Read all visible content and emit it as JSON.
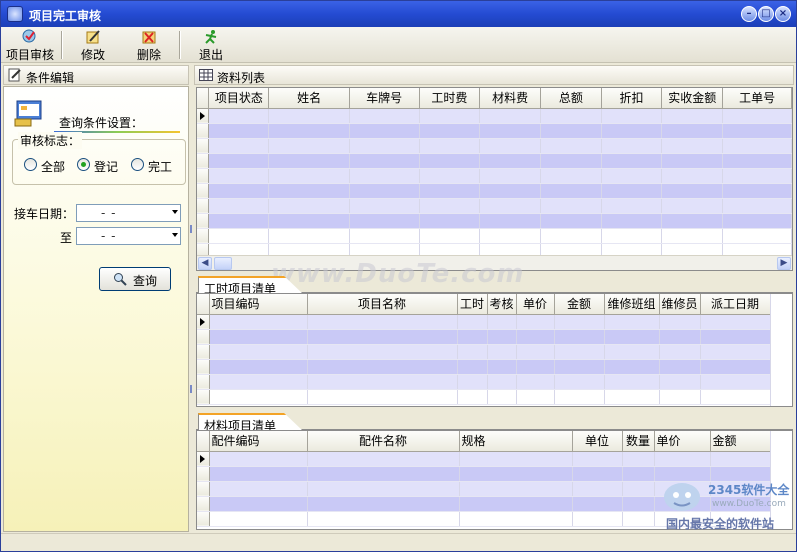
{
  "window": {
    "title": "项目完工审核"
  },
  "toolbar": {
    "items": [
      {
        "label": "项目审核",
        "icon": "audit-icon"
      },
      {
        "label": "修改",
        "icon": "edit-icon"
      },
      {
        "label": "删除",
        "icon": "delete-icon"
      },
      {
        "label": "退出",
        "icon": "exit-icon"
      }
    ]
  },
  "left": {
    "header": "条件编辑",
    "condition_title": "查询条件设置：",
    "audit_flag": {
      "label": "审核标志：",
      "options": [
        "全部",
        "登记",
        "完工"
      ],
      "selected": "登记"
    },
    "date_label": "接车日期：",
    "to_label": "至",
    "date_from": "-  -",
    "date_to": "-  -",
    "query_button": "查询"
  },
  "list": {
    "header": "资料列表",
    "columns": [
      "项目状态",
      "姓名",
      "车牌号",
      "工时费",
      "材料费",
      "总额",
      "折扣",
      "实收金额",
      "工单号"
    ]
  },
  "labor": {
    "tab": "工时项目清单",
    "columns": [
      "项目编码",
      "项目名称",
      "工时",
      "考核",
      "单价",
      "金额",
      "维修班组",
      "维修员",
      "派工日期"
    ]
  },
  "material": {
    "tab": "材料项目清单",
    "columns": [
      "配件编码",
      "配件名称",
      "规格",
      "单位",
      "数量",
      "单价",
      "金额"
    ]
  },
  "watermark": "www.DuoTe.com",
  "badge": {
    "brand": "2345软件大全",
    "url": "www.DuoTe.com",
    "slogan": "国内最安全的软件站"
  },
  "colors": {
    "title_bar": "#244bd2",
    "row_dark": "#c9c9f6",
    "row_light": "#e1e1fa",
    "tab_accent": "#f3a326"
  }
}
